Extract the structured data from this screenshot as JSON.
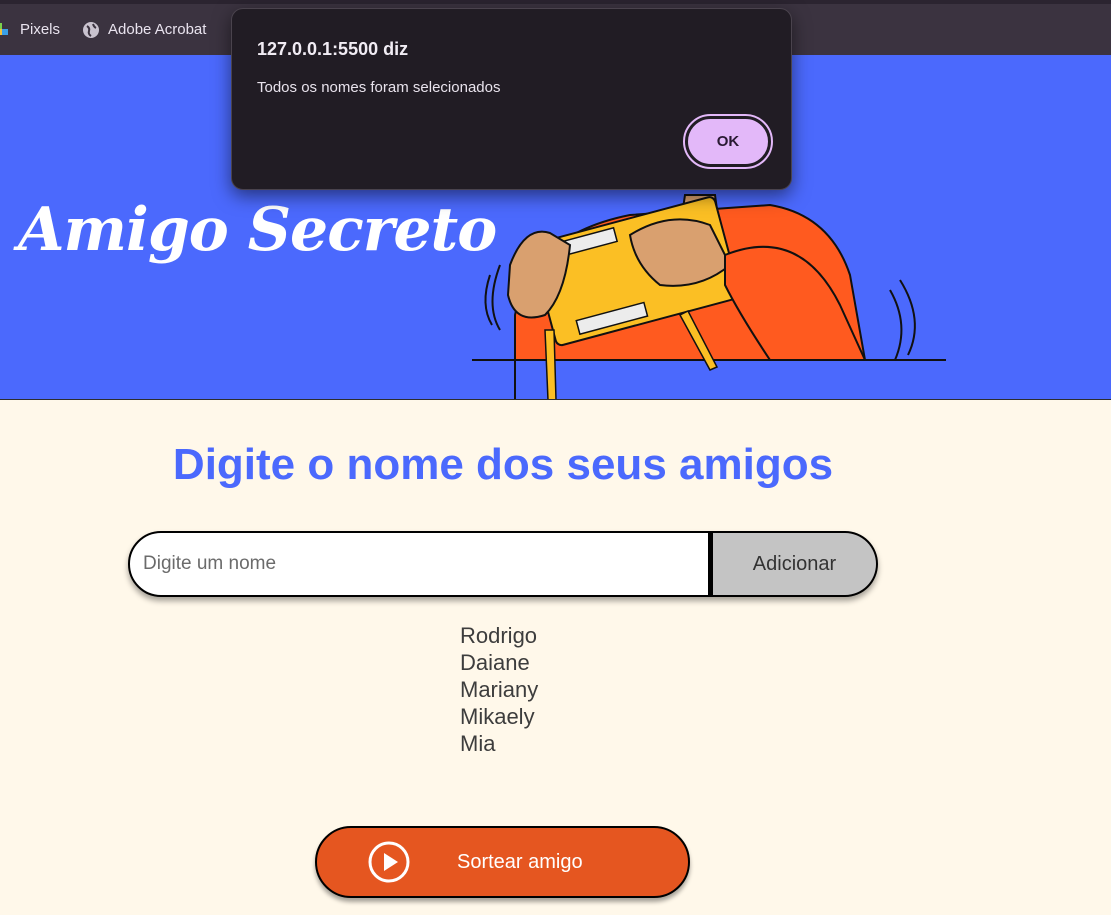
{
  "browser": {
    "bookmarks": [
      {
        "label": "Pixels",
        "icon": "pixels-icon"
      },
      {
        "label": "Adobe Acrobat",
        "icon": "globe-icon"
      }
    ]
  },
  "hero": {
    "title": "Amigo Secreto",
    "illustration": "person-holding-gift-illustration"
  },
  "main": {
    "heading": "Digite o nome dos seus amigos",
    "input": {
      "placeholder": "Digite um nome",
      "value": ""
    },
    "add_label": "Adicionar",
    "friends": [
      "Rodrigo",
      "Daiane",
      "Mariany",
      "Mikaely",
      "Mia"
    ],
    "draw_label": "Sortear amigo",
    "draw_icon": "play-circle-icon"
  },
  "alert": {
    "title": "127.0.0.1:5500 diz",
    "message": "Todos os nomes foram selecionados",
    "ok_label": "OK"
  },
  "colors": {
    "primary": "#4b69fd",
    "draw_button": "#e55620",
    "background": "#fff8ea",
    "alert_bg": "#211c24",
    "ok_button": "#e3b8f9"
  }
}
